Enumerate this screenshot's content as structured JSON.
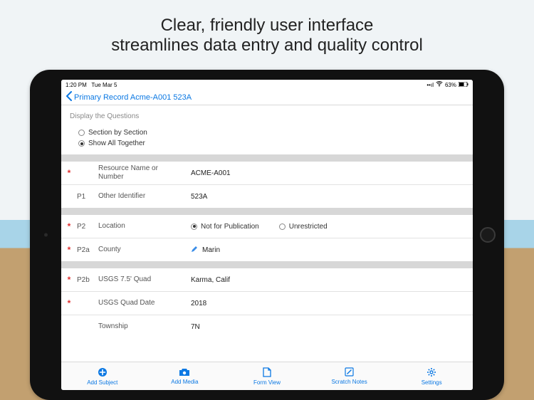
{
  "headline": {
    "line1": "Clear, friendly user interface",
    "line2": "streamlines data entry and quality control"
  },
  "statusbar": {
    "time": "1:20 PM",
    "date": "Tue Mar 5",
    "battery": "63%"
  },
  "nav": {
    "title": "Primary Record Acme-A001 523A"
  },
  "display_questions": {
    "heading": "Display the Questions",
    "option_section": "Section by Section",
    "option_all": "Show All Together",
    "selected": "all"
  },
  "rows": {
    "resource_name": {
      "required": "*",
      "code": "",
      "label": "Resource Name or Number",
      "value": "ACME-A001"
    },
    "other_id": {
      "required": "",
      "code": "P1",
      "label": "Other Identifier",
      "value": "523A"
    },
    "location": {
      "required": "*",
      "code": "P2",
      "label": "Location",
      "opt_notpub": "Not for Publication",
      "opt_unrestricted": "Unrestricted"
    },
    "county": {
      "required": "*",
      "code": "P2a",
      "label": "County",
      "value": "Marin"
    },
    "quad": {
      "required": "*",
      "code": "P2b",
      "label": "USGS 7.5' Quad",
      "value": "Karma, Calif"
    },
    "quad_date": {
      "required": "*",
      "code": "",
      "label": "USGS Quad Date",
      "value": "2018"
    },
    "township": {
      "required": "",
      "code": "",
      "label": "Township",
      "value": "7N"
    }
  },
  "tabs": {
    "add_subject": "Add Subject",
    "add_media": "Add Media",
    "form_view": "Form View",
    "scratch_notes": "Scratch Notes",
    "settings": "Settings"
  }
}
